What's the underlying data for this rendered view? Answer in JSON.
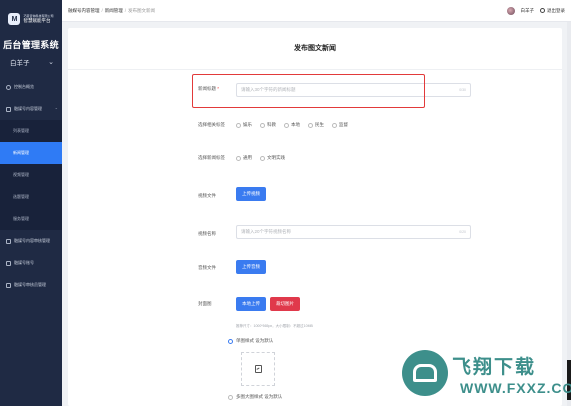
{
  "brand": {
    "logo_letter": "M",
    "line1": "巧思咨询科技有限公司",
    "line2": "智慧赋能平台"
  },
  "sidebar": {
    "title": "后台管理系统",
    "user": "白羊子",
    "items": [
      {
        "label": "控制台概览"
      },
      {
        "label": "融媒号内容管理"
      },
      {
        "label": "融媒号内容审核管理"
      },
      {
        "label": "融媒号账号"
      },
      {
        "label": "融媒号审核员管理"
      }
    ],
    "subitems": [
      {
        "label": "列表管理",
        "active": false
      },
      {
        "label": "新闻管理",
        "active": true
      },
      {
        "label": "视频管理",
        "active": false
      },
      {
        "label": "选题管理",
        "active": false
      },
      {
        "label": "服务管理",
        "active": false
      }
    ]
  },
  "header": {
    "breadcrumbs": [
      "融媒号内容管理",
      "新闻管理",
      "发布图文新闻"
    ],
    "username": "白羊子",
    "logout": "退出登录"
  },
  "form": {
    "page_title": "发布图文新闻",
    "title_label": "新闻标题",
    "title_required": "*",
    "title_placeholder": "请输入30个字符的新闻标题",
    "title_count": "0/30",
    "category_label": "选择相关标签",
    "categories": [
      "娱乐",
      "科教",
      "本地",
      "民生",
      "监督"
    ],
    "tag_label": "选择新闻标签",
    "tags": [
      "通用",
      "文明实践"
    ],
    "video_label": "视频文件",
    "video_button": "上传视频",
    "video_name_label": "视频名称",
    "video_name_placeholder": "请输入20个字符视频名称",
    "video_name_count": "0/20",
    "audio_label": "音频文件",
    "audio_button": "上传音频",
    "cover_label": "封面图",
    "cover_local_button": "本地上传",
    "cover_pick_button": "裁切图片",
    "cover_hint": "推荐尺寸：1000*565px，大小限制：不超过10MB",
    "cover_radio_1": "单图样式 设为默认",
    "cover_radio_2": "多图大图样式 设为默认"
  },
  "watermark": {
    "title": "飞翔下载",
    "url": "WWW.FXXZ.COM"
  },
  "colors": {
    "sidebar_bg": "#1f2a44",
    "accent": "#2f7bf5",
    "danger": "#e0394b",
    "highlight": "#e23a3a"
  }
}
